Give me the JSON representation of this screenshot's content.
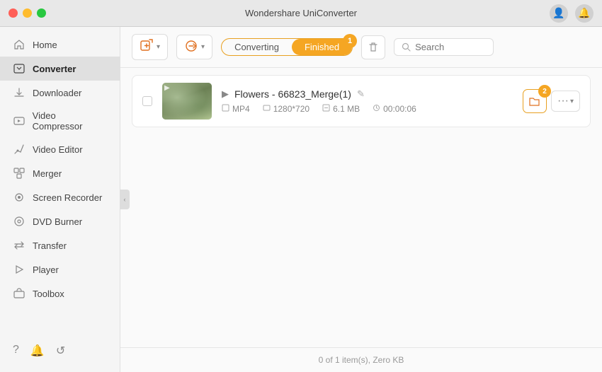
{
  "app": {
    "title": "Wondershare UniConverter"
  },
  "titlebar": {
    "user_icon": "👤",
    "bell_icon": "🔔"
  },
  "sidebar": {
    "items": [
      {
        "id": "home",
        "label": "Home",
        "icon": "⌂"
      },
      {
        "id": "converter",
        "label": "Converter",
        "icon": "⇄",
        "active": true
      },
      {
        "id": "downloader",
        "label": "Downloader",
        "icon": "↓"
      },
      {
        "id": "video-compressor",
        "label": "Video Compressor",
        "icon": "⊡"
      },
      {
        "id": "video-editor",
        "label": "Video Editor",
        "icon": "✂"
      },
      {
        "id": "merger",
        "label": "Merger",
        "icon": "⊞"
      },
      {
        "id": "screen-recorder",
        "label": "Screen Recorder",
        "icon": "◉"
      },
      {
        "id": "dvd-burner",
        "label": "DVD Burner",
        "icon": "◎"
      },
      {
        "id": "transfer",
        "label": "Transfer",
        "icon": "⇆"
      },
      {
        "id": "player",
        "label": "Player",
        "icon": "▶"
      },
      {
        "id": "toolbox",
        "label": "Toolbox",
        "icon": "⚙"
      }
    ],
    "bottom_icons": [
      "?",
      "🔔",
      "↺"
    ]
  },
  "toolbar": {
    "add_button_label": "+",
    "convert_button_label": "+",
    "tab_converting": "Converting",
    "tab_finished": "Finished",
    "tab_active": "Finished",
    "search_placeholder": "Search",
    "badge1": "1",
    "badge2": "2"
  },
  "files": [
    {
      "name": "Flowers - 66823_Merge(1)",
      "format": "MP4",
      "resolution": "1280*720",
      "size": "6.1 MB",
      "duration": "00:00:06",
      "checked": false
    }
  ],
  "status_bar": {
    "text": "0 of 1 item(s), Zero KB"
  }
}
